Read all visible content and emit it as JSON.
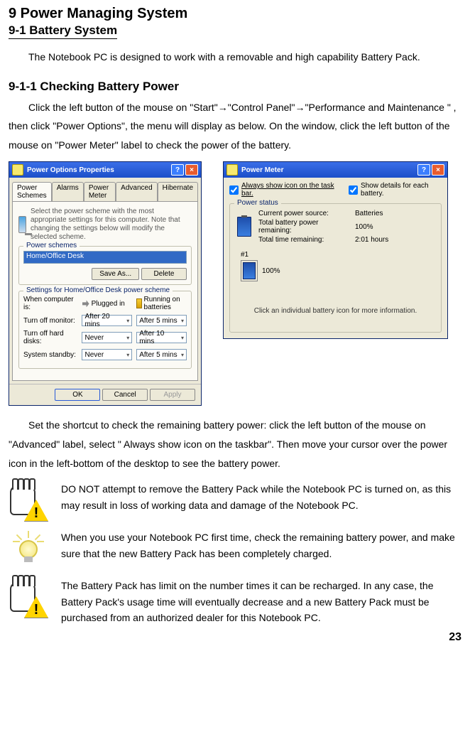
{
  "h1": "9 Power Managing System",
  "h2": "9-1 Battery System",
  "p1": "The Notebook PC is designed to work with a removable and high capability Battery Pack.",
  "h3": "9-1-1 Checking Battery Power",
  "p2": "Click the left button of the mouse on \"Start\"→\"Control Panel\"→\"Performance and Maintenance \" , then click \"Power Options\", the menu will display as below. On the window, click the left button of the mouse on \"Power Meter\" label to check the power of the battery.",
  "win1": {
    "title": "Power Options Properties",
    "tabs": [
      "Power Schemes",
      "Alarms",
      "Power Meter",
      "Advanced",
      "Hibernate"
    ],
    "desc": "Select the power scheme with the most appropriate settings for this computer. Note that changing the settings below will modify the selected scheme.",
    "scheme_legend": "Power schemes",
    "scheme_value": "Home/Office Desk",
    "saveas": "Save As...",
    "delete": "Delete",
    "settings_legend": "Settings for Home/Office Desk power scheme",
    "when_label": "When computer is:",
    "plugged": "Plugged in",
    "running": "Running on batteries",
    "rows": [
      {
        "lab": "Turn off monitor:",
        "c1": "After 20 mins",
        "c2": "After 5 mins"
      },
      {
        "lab": "Turn off hard disks:",
        "c1": "Never",
        "c2": "After 10 mins"
      },
      {
        "lab": "System standby:",
        "c1": "Never",
        "c2": "After 5 mins"
      }
    ],
    "ok": "OK",
    "cancel": "Cancel",
    "apply": "Apply"
  },
  "win2": {
    "title": "Power Meter",
    "chk1": "Always show icon on the task bar.",
    "chk2": "Show details for each battery.",
    "status_legend": "Power status",
    "lines": [
      {
        "l": "Current power source:",
        "r": "Batteries"
      },
      {
        "l": "Total battery power remaining:",
        "r": "100%"
      },
      {
        "l": "Total time remaining:",
        "r": "2:01 hours"
      }
    ],
    "num": "#1",
    "pct": "100%",
    "clickline": "Click an individual battery icon for more information."
  },
  "p3": "Set the shortcut to check the remaining battery power: click the left button of the mouse on \"Advanced\" label, select \" Always show icon on the taskbar\". Then move your cursor over the power icon in the left-bottom of the desktop to see the battery power.",
  "note1": "DO NOT attempt to remove the Battery Pack while the Notebook PC is turned on, as this may result in loss of working data and damage of the Notebook PC.",
  "note2": "When you use your Notebook PC first time, check the remaining battery power, and make sure that the new Battery Pack has been completely charged.",
  "note3": "The Battery Pack has limit on the number times it can be recharged. In any case, the Battery Pack's usage time will eventually decrease and a new Battery Pack must be purchased from an authorized dealer for this Notebook PC.",
  "pagenum": "23"
}
